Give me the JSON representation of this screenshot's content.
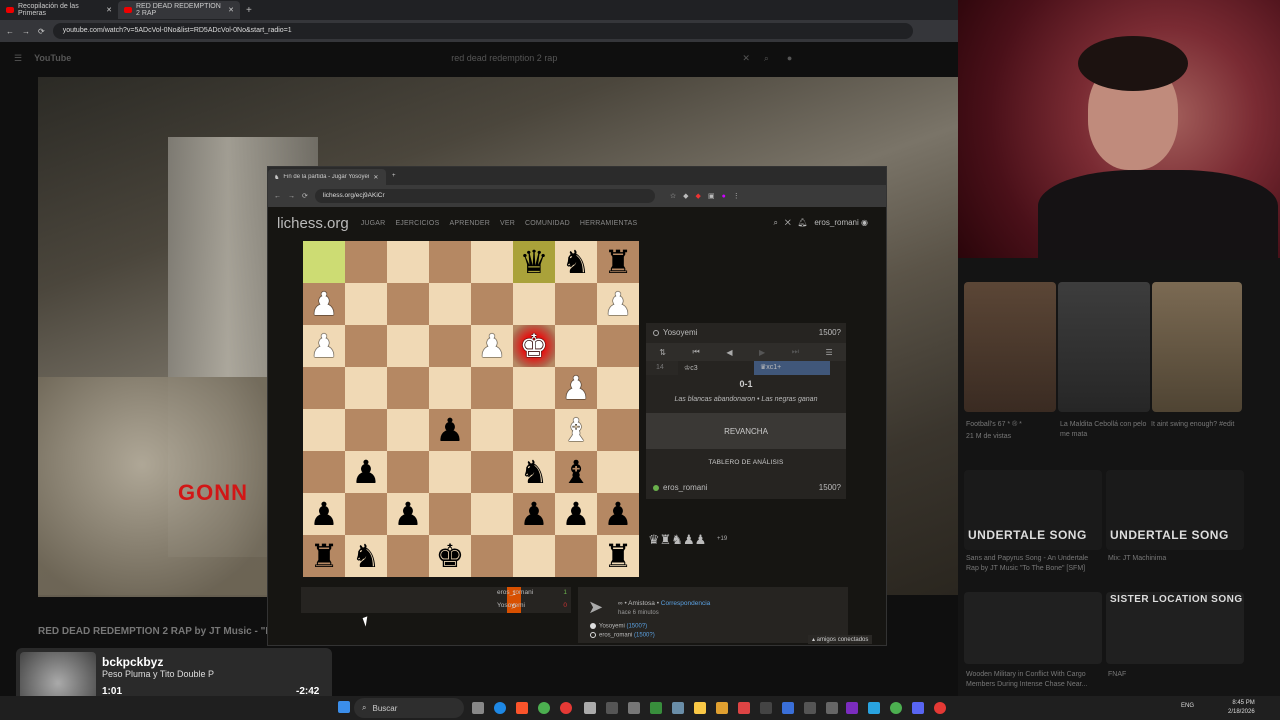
{
  "outer_browser": {
    "tabs": [
      {
        "label": "Recopilación de las Primeras"
      },
      {
        "label": "RED DEAD REDEMPTION 2 RAP"
      }
    ],
    "url": "youtube.com/watch?v=5ADcVol-0No&list=RD5ADcVol-0No&start_radio=1"
  },
  "youtube": {
    "logo": "YouTube",
    "search_text": "red dead redemption 2 rap",
    "video_overlay_text": "GONN",
    "video_title": "RED DEAD REDEMPTION 2 RAP by JT Music - \"Ro",
    "recommendations": [
      {
        "title": "Football's 67 * ® *",
        "meta": "21 M de vistas"
      },
      {
        "title": "La Maldita Cebollá con pelo me mata",
        "meta": ""
      },
      {
        "title": "It aint swing enough? #edit",
        "meta": ""
      },
      {
        "title": "Sans and Papyrus Song - An Undertale Rap by JT Music \"To The Bone\" [SFM]",
        "meta": ""
      },
      {
        "title": "Mix: JT Machinima",
        "meta": ""
      },
      {
        "title": "Wooden Military in Conflict With Cargo Members During Intense Chase Near...",
        "meta": ""
      },
      {
        "title": "FNAF",
        "meta": ""
      }
    ],
    "banners": [
      "UNDERTALE SONG",
      "UNDERTALE SONG",
      "SISTER LOCATION SONG"
    ]
  },
  "music_widget": {
    "title": "bckpckbyz",
    "artist": "Peso Pluma y Tito Double P",
    "current_time": "1:01",
    "remaining_time": "-2:42",
    "progress_fraction": 0.27
  },
  "taskbar": {
    "search_label": "Buscar",
    "language": "ENG",
    "time": "8:45 PM",
    "date": "2/18/2026"
  },
  "lichess_browser": {
    "tab_title": "Fin de la partida - Jugar Yosoyemi",
    "url": "lichess.org/ecj9AKiCr"
  },
  "lichess": {
    "logo": "lichess.org",
    "nav": [
      "JUGAR",
      "EJERCICIOS",
      "APRENDER",
      "VER",
      "COMUNIDAD",
      "HERRAMIENTAS"
    ],
    "username": "eros_romani",
    "board": [
      [
        "",
        "",
        "",
        "",
        "",
        "bq",
        "bn",
        "br"
      ],
      [
        "wp",
        "",
        "",
        "",
        "",
        "",
        "",
        "wp"
      ],
      [
        "wp",
        "",
        "",
        "",
        "wp",
        "wk",
        "",
        ""
      ],
      [
        "",
        "",
        "",
        "",
        "",
        "",
        "wp",
        ""
      ],
      [
        "",
        "",
        "",
        "bp",
        "",
        "",
        "wb",
        ""
      ],
      [
        "",
        "bp",
        "",
        "",
        "",
        "bn",
        "bb",
        ""
      ],
      [
        "bp",
        "",
        "bp",
        "",
        "",
        "bp",
        "bp",
        "bp"
      ],
      [
        "br",
        "bn",
        "",
        "bk",
        "",
        "",
        "",
        "br"
      ]
    ],
    "highlight_squares": [
      "a8",
      "f8"
    ],
    "check_square": "f6",
    "opponent": {
      "name": "Yosoyemi",
      "rating": "1500?"
    },
    "player": {
      "name": "eros_romani",
      "rating": "1500?"
    },
    "moves": {
      "number": "14",
      "white": "♔c3",
      "black": "♛xc1+"
    },
    "result": "0-1",
    "result_desc": "Las blancas abandonaron • Las negras ganan",
    "rematch_label": "REVANCHA",
    "analysis_label": "TABLERO DE ANÁLISIS",
    "captured": "♛♜♞♟♟",
    "material_diff": "+19",
    "crosstable": [
      {
        "num": "1",
        "name": "eros_romani",
        "score": "1"
      },
      {
        "num": "0",
        "name": "Yosoyemi",
        "score": "0"
      }
    ],
    "game_info": {
      "type": "∞ • Amistosa • ",
      "type_link": "Correspondencia",
      "time_ago": "hace 6 minutos",
      "white": "Yosoyemi",
      "white_rating": "(1500?)",
      "black": "eros_romani",
      "black_rating": "(1500?)"
    },
    "friends_label": "▴ amigos conectados"
  },
  "colors": {
    "light_square": "#f0d9b5",
    "dark_square": "#b58863",
    "highlight": "#cddc73",
    "check": "#ff2020",
    "accent_link": "#5aa0e0"
  }
}
